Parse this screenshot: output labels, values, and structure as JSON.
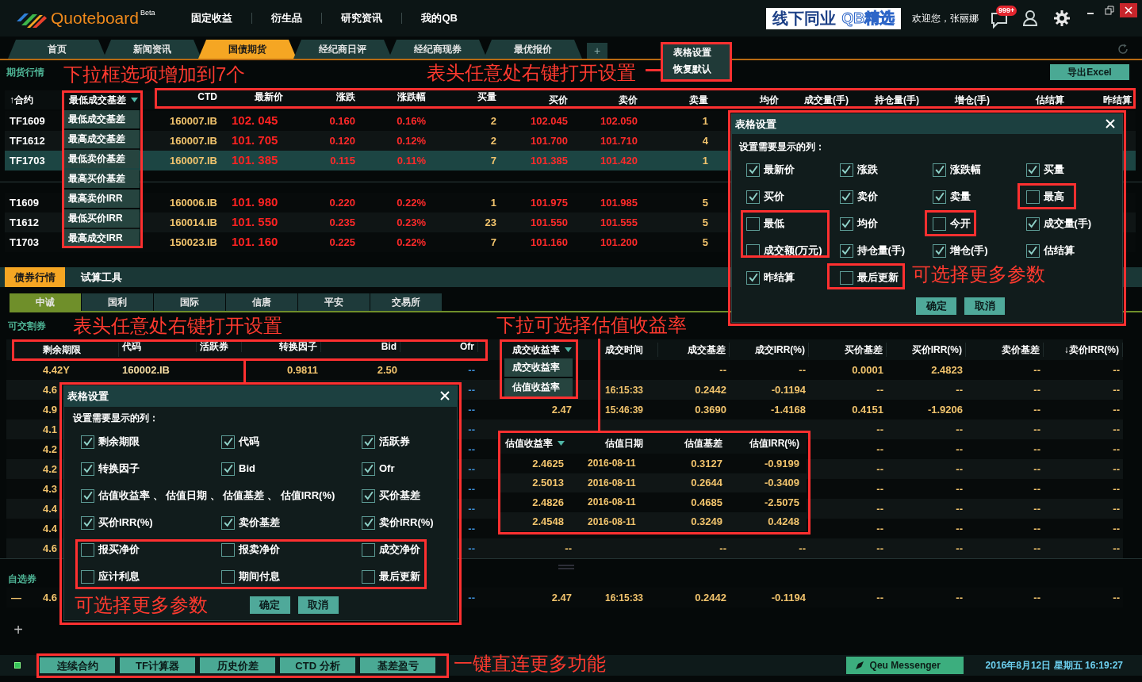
{
  "app": {
    "logo": "Quoteboard",
    "logo_badge": "Beta",
    "menu": [
      "固定收益",
      "衍生品",
      "研究资讯",
      "我的QB"
    ],
    "banner": {
      "text": "线下同业",
      "highlight": "QB精选"
    },
    "greeting": "欢迎您，张丽娜",
    "notification_badge": "999+"
  },
  "tabs": [
    {
      "label": "首页",
      "selected": false
    },
    {
      "label": "新闻资讯",
      "selected": false
    },
    {
      "label": "国债期货",
      "selected": true
    },
    {
      "label": "经纪商日评",
      "selected": false
    },
    {
      "label": "经纪商现券",
      "selected": false
    },
    {
      "label": "最优报价",
      "selected": false
    }
  ],
  "tab_add": "+",
  "context_menu": [
    "表格设置",
    "恢复默认"
  ],
  "futures": {
    "title": "期货行情",
    "export_button": "导出Excel",
    "columns": [
      {
        "label": "↑合约",
        "kind": "header"
      },
      {
        "label": "最低成交基差",
        "kind": "dropdown"
      },
      {
        "label": "CTD",
        "kind": "header"
      },
      {
        "label": "最新价",
        "kind": "header"
      },
      {
        "label": "涨跌",
        "kind": "header"
      },
      {
        "label": "涨跌幅",
        "kind": "header"
      },
      {
        "label": "买量",
        "kind": "header"
      },
      {
        "label": "买价",
        "kind": "header"
      },
      {
        "label": "卖价",
        "kind": "header"
      },
      {
        "label": "卖量",
        "kind": "header"
      },
      {
        "label": "均价",
        "kind": "header"
      },
      {
        "label": "成交量(手)",
        "kind": "header"
      },
      {
        "label": "持仓量(手)",
        "kind": "header"
      },
      {
        "label": "增仓(手)",
        "kind": "header"
      },
      {
        "label": "估结算",
        "kind": "header"
      },
      {
        "label": "昨结算",
        "kind": "header"
      }
    ],
    "dropdown_options": [
      "最低成交基差",
      "最高成交基差",
      "最低卖价基差",
      "最高买价基差",
      "最高卖价IRR",
      "最低买价IRR",
      "最高成交IRR"
    ],
    "groups": [
      [
        {
          "selected": false,
          "cells": [
            "TF1609",
            null,
            "160007.IB",
            "102. 045",
            "0.160",
            "0.16%",
            "2",
            "102.045",
            "102.050",
            "1"
          ]
        },
        {
          "selected": false,
          "cells": [
            "TF1612",
            null,
            "160007.IB",
            "101. 705",
            "0.120",
            "0.12%",
            "2",
            "101.700",
            "101.710",
            "4"
          ]
        },
        {
          "selected": true,
          "cells": [
            "TF1703",
            null,
            "160007.IB",
            "101. 385",
            "0.115",
            "0.11%",
            "7",
            "101.385",
            "101.420",
            "1"
          ]
        }
      ],
      [
        {
          "selected": false,
          "cells": [
            "T1609",
            null,
            "160006.IB",
            "101. 980",
            "0.220",
            "0.22%",
            "1",
            "101.975",
            "101.985",
            "5"
          ]
        },
        {
          "selected": false,
          "cells": [
            "T1612",
            null,
            "160014.IB",
            "101. 550",
            "0.235",
            "0.23%",
            "23",
            "101.550",
            "101.555",
            "5"
          ]
        },
        {
          "selected": false,
          "cells": [
            "T1703",
            null,
            "150023.IB",
            "101. 160",
            "0.225",
            "0.22%",
            "7",
            "101.160",
            "101.200",
            "5"
          ]
        }
      ]
    ]
  },
  "futures_settings": {
    "title": "表格设置",
    "subtitle": "设置需要显示的列：",
    "buttons": [
      "确定",
      "取消"
    ],
    "options": [
      {
        "label": "最新价",
        "checked": true
      },
      {
        "label": "涨跌",
        "checked": true
      },
      {
        "label": "涨跌幅",
        "checked": true
      },
      {
        "label": "买量",
        "checked": true
      },
      {
        "label": "买价",
        "checked": true
      },
      {
        "label": "卖价",
        "checked": true
      },
      {
        "label": "卖量",
        "checked": true
      },
      {
        "label": "最高",
        "checked": false
      },
      {
        "label": "最低",
        "checked": false
      },
      {
        "label": "均价",
        "checked": true
      },
      {
        "label": "今开",
        "checked": false
      },
      {
        "label": "成交量(手)",
        "checked": true
      },
      {
        "label": "成交额(万元)",
        "checked": false
      },
      {
        "label": "持仓量(手)",
        "checked": true
      },
      {
        "label": "增仓(手)",
        "checked": true
      },
      {
        "label": "估结算",
        "checked": true
      },
      {
        "label": "昨结算",
        "checked": true
      },
      {
        "label": "最后更新",
        "checked": false
      }
    ]
  },
  "bond_tabs": [
    {
      "label": "债券行情",
      "selected": true
    },
    {
      "label": "试算工具",
      "selected": false
    }
  ],
  "bond_sub_tabs": [
    {
      "label": "中诚",
      "selected": true
    },
    {
      "label": "国利",
      "selected": false
    },
    {
      "label": "国际",
      "selected": false
    },
    {
      "label": "信唐",
      "selected": false
    },
    {
      "label": "平安",
      "selected": false
    },
    {
      "label": "交易所",
      "selected": false
    }
  ],
  "bonds": {
    "title": "可交割券",
    "columns": [
      {
        "label": "剩余期限",
        "kind": "header"
      },
      {
        "label": "代码",
        "kind": "header"
      },
      {
        "label": "活跃券",
        "kind": "header"
      },
      {
        "label": "转换因子",
        "kind": "header"
      },
      {
        "label": "Bid",
        "kind": "header"
      },
      {
        "label": "Ofr",
        "kind": "header"
      },
      {
        "label": "成交收益率",
        "kind": "dropdown"
      },
      {
        "label": "成交时间",
        "kind": "header"
      },
      {
        "label": "成交基差",
        "kind": "header"
      },
      {
        "label": "成交IRR(%)",
        "kind": "header"
      },
      {
        "label": "买价基差",
        "kind": "header"
      },
      {
        "label": "买价IRR(%)",
        "kind": "header"
      },
      {
        "label": "卖价基差",
        "kind": "header"
      },
      {
        "label": "↓卖价IRR(%)",
        "kind": "header"
      }
    ],
    "dropdown_options": [
      "成交收益率",
      "估值收益率"
    ],
    "rows": [
      {
        "cells": [
          "4.42Y",
          "160002.IB",
          null,
          "0.9811",
          "2.50",
          "--",
          null,
          null,
          "--",
          "--",
          "0.0001",
          "2.4823",
          "--",
          "--"
        ]
      },
      {
        "cells": [
          "4.6",
          null,
          null,
          null,
          null,
          "--",
          null,
          "16:15:33",
          "0.2442",
          "-0.1194",
          "--",
          "--",
          "--",
          "--"
        ]
      },
      {
        "cells": [
          "4.9",
          null,
          null,
          null,
          null,
          "--",
          "2.47",
          "15:46:39",
          "0.3690",
          "-1.4168",
          "0.4151",
          "-1.9206",
          "--",
          "--"
        ]
      },
      {
        "cells": [
          "4.1",
          null,
          null,
          null,
          null,
          "--",
          null,
          null,
          null,
          null,
          "--",
          "--",
          "--",
          "--"
        ]
      },
      {
        "cells": [
          "4.2",
          null,
          null,
          null,
          null,
          "--",
          null,
          null,
          null,
          null,
          "--",
          "--",
          "--",
          "--"
        ]
      },
      {
        "cells": [
          "4.2",
          null,
          null,
          null,
          null,
          "--",
          null,
          null,
          null,
          null,
          "--",
          "--",
          "--",
          "--"
        ]
      },
      {
        "cells": [
          "4.3",
          null,
          null,
          null,
          null,
          "--",
          null,
          null,
          null,
          null,
          "--",
          "--",
          "--",
          "--"
        ]
      },
      {
        "cells": [
          "4.4",
          null,
          null,
          null,
          null,
          "--",
          null,
          null,
          null,
          null,
          "--",
          "--",
          "--",
          "--"
        ]
      },
      {
        "cells": [
          "4.4",
          null,
          null,
          null,
          null,
          "--",
          null,
          null,
          null,
          null,
          "--",
          "--",
          "--",
          "--"
        ]
      },
      {
        "cells": [
          "4.6",
          null,
          null,
          null,
          null,
          "--",
          "--",
          null,
          "--",
          "--",
          "--",
          "--",
          "--",
          "--"
        ]
      }
    ],
    "watchlist_title": "自选券",
    "watchlist_rows": [
      {
        "marker": "—",
        "cells": [
          "4.6",
          null,
          null,
          null,
          null,
          "--",
          "2.47",
          "16:15:33",
          "0.2442",
          "-0.1194",
          "--",
          "--",
          "--",
          "--"
        ]
      }
    ],
    "add_button": "+"
  },
  "valuation_popup": {
    "columns": [
      {
        "label": "估值收益率",
        "kind": "dropdown"
      },
      {
        "label": "估值日期",
        "kind": "header"
      },
      {
        "label": "估值基差",
        "kind": "header"
      },
      {
        "label": "估值IRR(%)",
        "kind": "header"
      }
    ],
    "rows": [
      [
        "2.4625",
        "2016-08-11",
        "0.3127",
        "-0.9199"
      ],
      [
        "2.5013",
        "2016-08-11",
        "0.2644",
        "-0.3409"
      ],
      [
        "2.4826",
        "2016-08-11",
        "0.4685",
        "-2.5075"
      ],
      [
        "2.4548",
        "2016-08-11",
        "0.3249",
        "0.4248"
      ]
    ]
  },
  "bond_settings": {
    "title": "表格设置",
    "subtitle": "设置需要显示的列：",
    "buttons": [
      "确定",
      "取消"
    ],
    "options": [
      {
        "label": "剩余期限",
        "checked": true,
        "kind": "single"
      },
      {
        "label": "代码",
        "checked": true,
        "kind": "single"
      },
      {
        "label": "活跃券",
        "checked": true,
        "kind": "single"
      },
      {
        "label": "转换因子",
        "checked": true,
        "kind": "single"
      },
      {
        "label": "Bid",
        "checked": true,
        "kind": "single"
      },
      {
        "label": "Ofr",
        "checked": true,
        "kind": "single"
      },
      {
        "label": "估值收益率 、 估值日期 、 估值基差 、 估值IRR(%)",
        "checked": true,
        "kind": "wide"
      },
      {
        "label": "买价基差",
        "checked": true,
        "kind": "single"
      },
      {
        "label": "买价IRR(%)",
        "checked": true,
        "kind": "single"
      },
      {
        "label": "卖价基差",
        "checked": true,
        "kind": "single"
      },
      {
        "label": "卖价IRR(%)",
        "checked": true,
        "kind": "single"
      },
      {
        "label": "报买净价",
        "checked": false,
        "kind": "single"
      },
      {
        "label": "报卖净价",
        "checked": false,
        "kind": "single"
      },
      {
        "label": "成交净价",
        "checked": false,
        "kind": "single"
      },
      {
        "label": "应计利息",
        "checked": false,
        "kind": "single"
      },
      {
        "label": "期间付息",
        "checked": false,
        "kind": "single"
      },
      {
        "label": "最后更新",
        "checked": false,
        "kind": "single"
      }
    ]
  },
  "annotations": [
    "下拉框选项增加到7个",
    "表头任意处右键打开设置",
    "可选择更多参数",
    "表头任意处右键打开设置",
    "下拉可选择估值收益率",
    "可选择更多参数",
    "一键直连更多功能"
  ],
  "status_bar": {
    "buttons": [
      "连续合约",
      "TF计算器",
      "历史价差",
      "CTD 分析",
      "基差盈亏"
    ],
    "messenger": "Qeu Messenger",
    "datetime": "2016年8月12日 星期五 16:19:27"
  }
}
